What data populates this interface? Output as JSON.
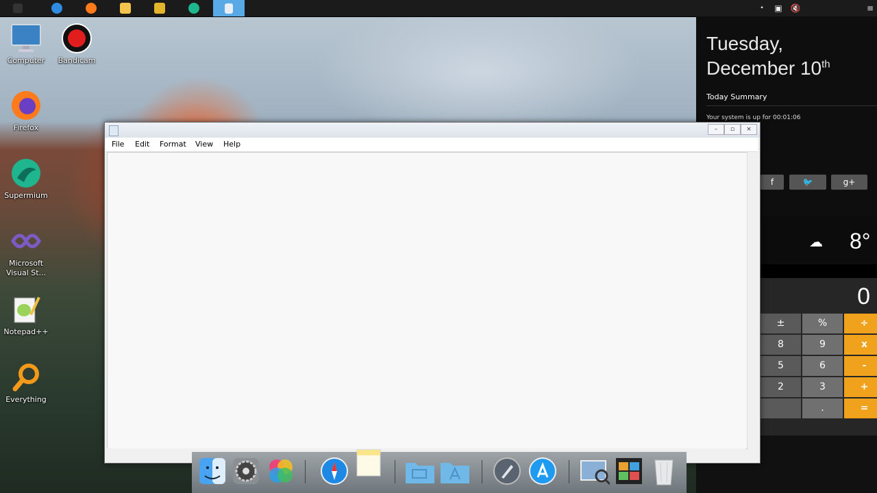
{
  "taskbar": {
    "items": [
      {
        "name": "start-icon",
        "color": "#333333"
      },
      {
        "name": "internet-explorer-icon",
        "color": "#2f8be0"
      },
      {
        "name": "firefox-icon",
        "color": "#ff7a1a"
      },
      {
        "name": "file-explorer-icon",
        "color": "#f3c44d"
      },
      {
        "name": "media-player-icon",
        "color": "#e3b52a"
      },
      {
        "name": "supermium-icon",
        "color": "#1fb58f"
      },
      {
        "name": "notepad-icon",
        "color": "#e8eef5"
      }
    ],
    "tray": [
      "•",
      "▣",
      "🔇"
    ]
  },
  "desktop": {
    "icons": [
      {
        "label": "Computer",
        "icon": "computer-icon",
        "color": "#3b82c4"
      },
      {
        "label": "Bandicam",
        "icon": "bandicam-icon",
        "color": "#e11d1d"
      },
      {
        "label": "Firefox",
        "icon": "firefox-icon",
        "color": "#ff7a1a"
      },
      {
        "label": "Supermium",
        "icon": "supermium-icon",
        "color": "#1fb58f"
      },
      {
        "label": "Microsoft Visual St...",
        "icon": "visual-studio-icon",
        "color": "#7c5cc4"
      },
      {
        "label": "Notepad++",
        "icon": "notepad-plus-plus-icon",
        "color": "#9bd35a"
      },
      {
        "label": "Everything",
        "icon": "everything-search-icon",
        "color": "#f39a1a"
      }
    ]
  },
  "sidepanel": {
    "day": "Tuesday,",
    "date": "December 10",
    "date_suffix": "th",
    "summary_title": "Today Summary",
    "uptime": "Your system is up for 00:01:06",
    "social": [
      "f",
      "🐦",
      "g+"
    ],
    "weather": {
      "icon": "cloud-icon",
      "temp": "8°"
    },
    "calculator": {
      "display": "0",
      "keys": [
        [
          "±",
          "%",
          "÷"
        ],
        [
          "8",
          "9",
          "x"
        ],
        [
          "5",
          "6",
          "-"
        ],
        [
          "2",
          "3",
          "+"
        ],
        [
          "",
          ".",
          "="
        ]
      ]
    }
  },
  "notepad": {
    "menu": [
      "File",
      "Edit",
      "Format",
      "View",
      "Help"
    ],
    "window_buttons": [
      "–",
      "▫",
      "×"
    ],
    "content": ""
  },
  "dock": {
    "items": [
      {
        "name": "finder-icon",
        "color": "#4aa3f0"
      },
      {
        "name": "system-preferences-icon",
        "color": "#555555"
      },
      {
        "name": "color-sync-icon",
        "color": "#e8457a"
      },
      {
        "name": "safari-icon",
        "color": "#1e88e5"
      },
      {
        "name": "notes-icon",
        "color": "#fbe58a"
      },
      {
        "name": "folder-icon",
        "color": "#6fb8e8"
      },
      {
        "name": "applications-folder-icon",
        "color": "#6fb8e8"
      },
      {
        "name": "launchpad-icon",
        "color": "#5a6470"
      },
      {
        "name": "app-store-icon",
        "color": "#1e9af0"
      },
      {
        "name": "preview-icon",
        "color": "#8ab0d8"
      },
      {
        "name": "photo-booth-icon",
        "color": "#222222"
      },
      {
        "name": "trash-icon",
        "color": "#e6e8ea"
      }
    ]
  }
}
